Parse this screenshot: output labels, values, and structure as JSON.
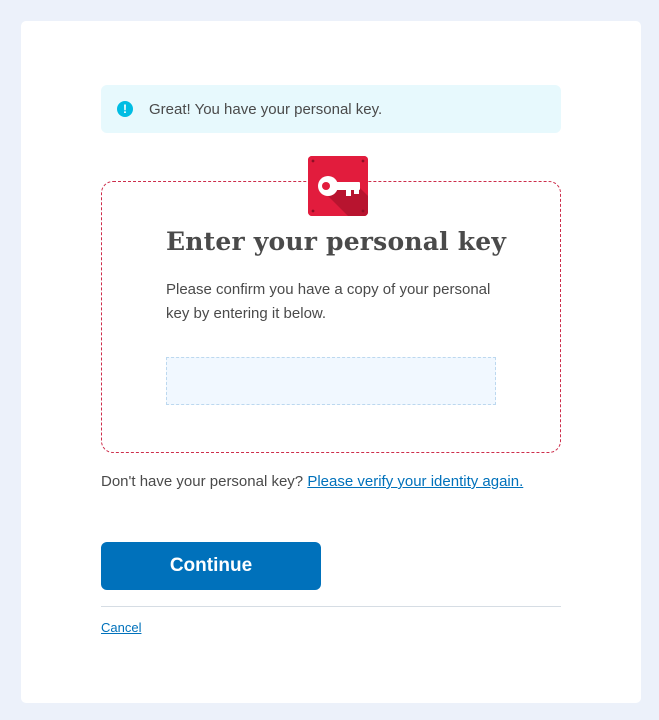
{
  "alert": {
    "icon": "info-exclamation-icon",
    "text": "Great! You have your personal key.",
    "icon_color": "#00bde3",
    "background": "#e7f9fd"
  },
  "key_badge": {
    "icon": "key-icon",
    "color": "#e21c3d"
  },
  "main": {
    "heading": "Enter your personal key",
    "instructions": "Please confirm you have a copy of your personal key by entering it below.",
    "input_value": "",
    "input_placeholder": ""
  },
  "help": {
    "prefix": "Don't have your personal key?",
    "link_label": "Please verify your identity again."
  },
  "actions": {
    "continue_label": "Continue",
    "cancel_label": "Cancel",
    "primary_color": "#0071bb"
  }
}
